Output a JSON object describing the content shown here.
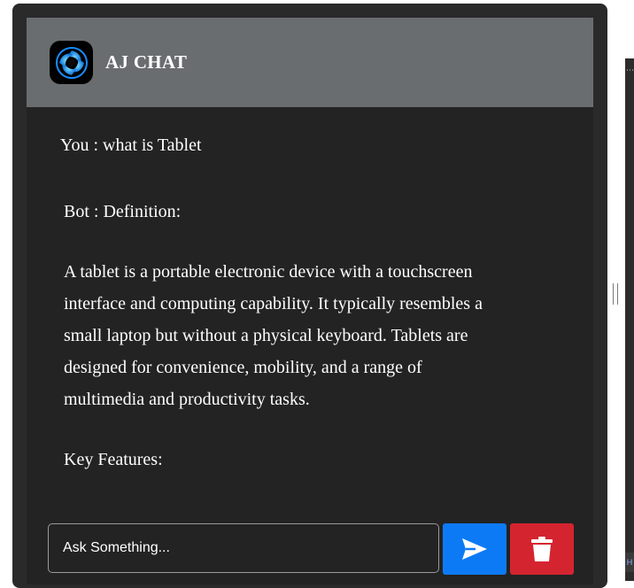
{
  "header": {
    "title": "AJ CHAT",
    "logo_icon": "swirl-logo-icon"
  },
  "messages": {
    "user": "You : what is Tablet",
    "bot_heading": "Bot : Definition:",
    "bot_lines": [
      "A tablet is a portable electronic device with a touchscreen",
      "interface and computing capability. It typically resembles a",
      "small laptop but without a physical keyboard. Tablets are",
      "designed for convenience, mobility, and a range of",
      "multimedia and productivity tasks."
    ],
    "bot_subheading": "Key Features:"
  },
  "input": {
    "placeholder": "Ask Something...",
    "value": ""
  },
  "buttons": {
    "send_icon": "send-arrow-icon",
    "delete_icon": "trash-icon"
  },
  "side_strip": {
    "dots": "⋯",
    "corner_label": "H"
  },
  "colors": {
    "header_bg": "#6a6d70",
    "chat_bg": "#232323",
    "send_bg": "#0d7af5",
    "delete_bg": "#d42430"
  }
}
